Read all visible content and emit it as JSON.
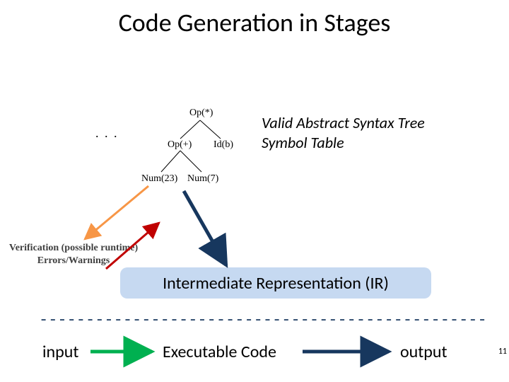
{
  "title": "Code Generation in Stages",
  "tree": {
    "op_star": "Op(*)",
    "op_plus": "Op(+)",
    "id_b": "Id(b)",
    "num23": "Num(23)",
    "num7": "Num(7)",
    "ellipsis": ". . ."
  },
  "ast_caption_line1": "Valid Abstract Syntax Tree",
  "ast_caption_line2": "Symbol Table",
  "verification_line1": "Verification (possible runtime)",
  "verification_line2": "Errors/Warnings",
  "ir_label": "Intermediate Representation (IR)",
  "dashes": "------------------------------------------------",
  "input_label": "input",
  "exec_label": "Executable Code",
  "output_label": "output",
  "page_number": "11",
  "colors": {
    "accent_dark_blue": "#17375e",
    "accent_green": "#00b050",
    "accent_red": "#c00000",
    "accent_orange": "#f79646",
    "ir_fill": "#c6d9f1"
  }
}
